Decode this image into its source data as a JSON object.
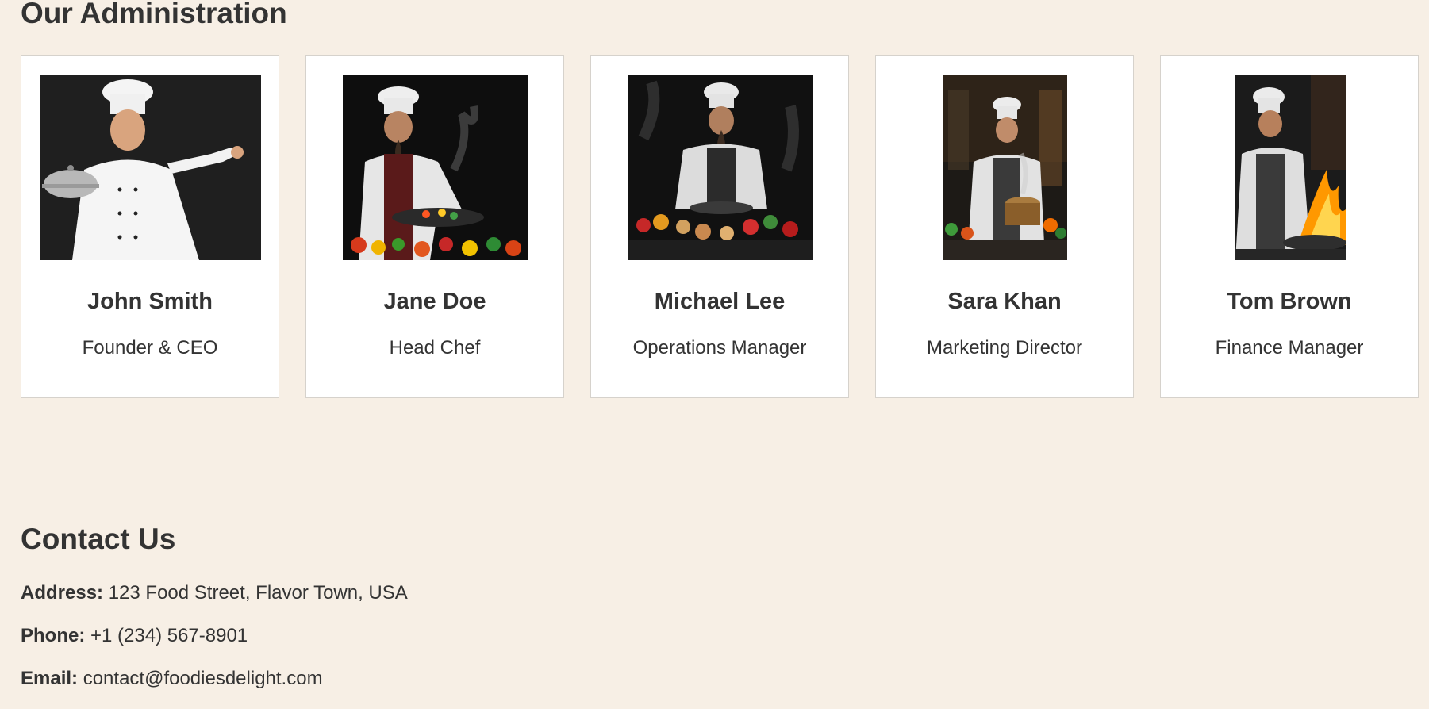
{
  "administration": {
    "title": "Our Administration",
    "members": [
      {
        "name": "John Smith",
        "role": "Founder & CEO",
        "photo_icon": "chef-holding-cloche-photo"
      },
      {
        "name": "Jane Doe",
        "role": "Head Chef",
        "photo_icon": "chef-cooking-vegetables-photo"
      },
      {
        "name": "Michael Lee",
        "role": "Operations Manager",
        "photo_icon": "chef-plating-vegetables-photo"
      },
      {
        "name": "Sara Khan",
        "role": "Marketing Director",
        "photo_icon": "chef-stirring-pot-photo"
      },
      {
        "name": "Tom Brown",
        "role": "Finance Manager",
        "photo_icon": "chef-flambe-pan-photo"
      }
    ]
  },
  "contact": {
    "title": "Contact Us",
    "address_label": "Address:",
    "address_value": "123 Food Street, Flavor Town, USA",
    "phone_label": "Phone:",
    "phone_value": "+1 (234) 567-8901",
    "email_label": "Email:",
    "email_value": "contact@foodiesdelight.com"
  },
  "colors": {
    "page_background": "#f7efe5",
    "card_background": "#ffffff",
    "card_border": "#d6d2cc",
    "text": "#333333"
  }
}
